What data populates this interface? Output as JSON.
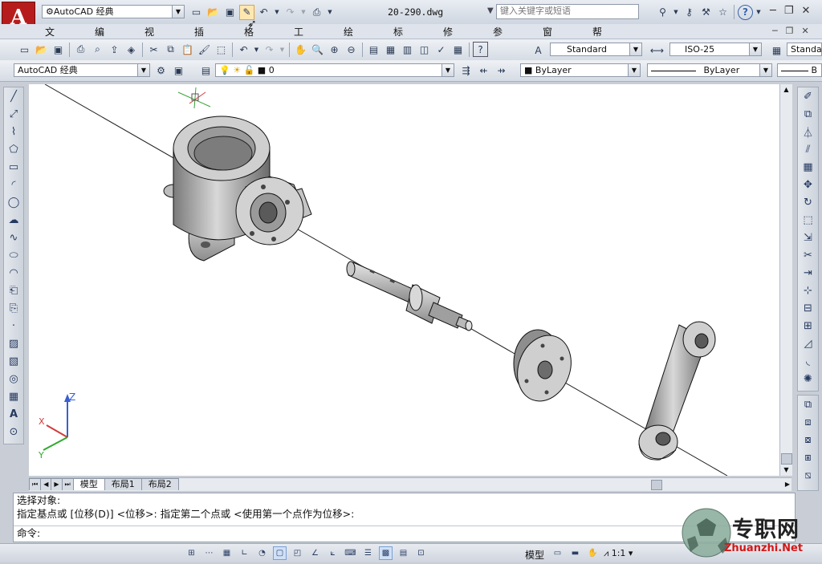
{
  "app": {
    "workspace_quick": "AutoCAD 经典",
    "file_name": "20-290.dwg",
    "search_placeholder": "键入关键字或短语"
  },
  "menu": [
    "文件(F)",
    "编辑(E)",
    "视图(V)",
    "插入(I)",
    "格式(O)",
    "工具(T)",
    "绘图(D)",
    "标注(N)",
    "修改(M)",
    "参数(P)",
    "窗口(W)",
    "帮助(H)"
  ],
  "styles": {
    "text_style": "Standard",
    "dim_style": "ISO-25",
    "table_style": "Standa"
  },
  "layers": {
    "workspace": "AutoCAD 经典",
    "current_layer": "0",
    "color": "ByLayer",
    "linetype": "ByLayer",
    "lineweight_partial": "B"
  },
  "tabs": [
    "模型",
    "布局1",
    "布局2"
  ],
  "command": {
    "line1": "选择对象:",
    "line2": "指定基点或 [位移(D)] <位移>:  指定第二个点或 <使用第一个点作为位移>:",
    "prompt": "命令:"
  },
  "status": {
    "model_label": "模型",
    "scale": "1:1"
  },
  "watermark": {
    "cn": "专职网",
    "url": "Zhuanzhi.Net"
  },
  "ucs": {
    "x": "X",
    "y": "Y",
    "z": "Z"
  },
  "colors": {
    "accent": "#b71c1c",
    "viewport": "#ffffff",
    "ui": "#d6dce5"
  }
}
